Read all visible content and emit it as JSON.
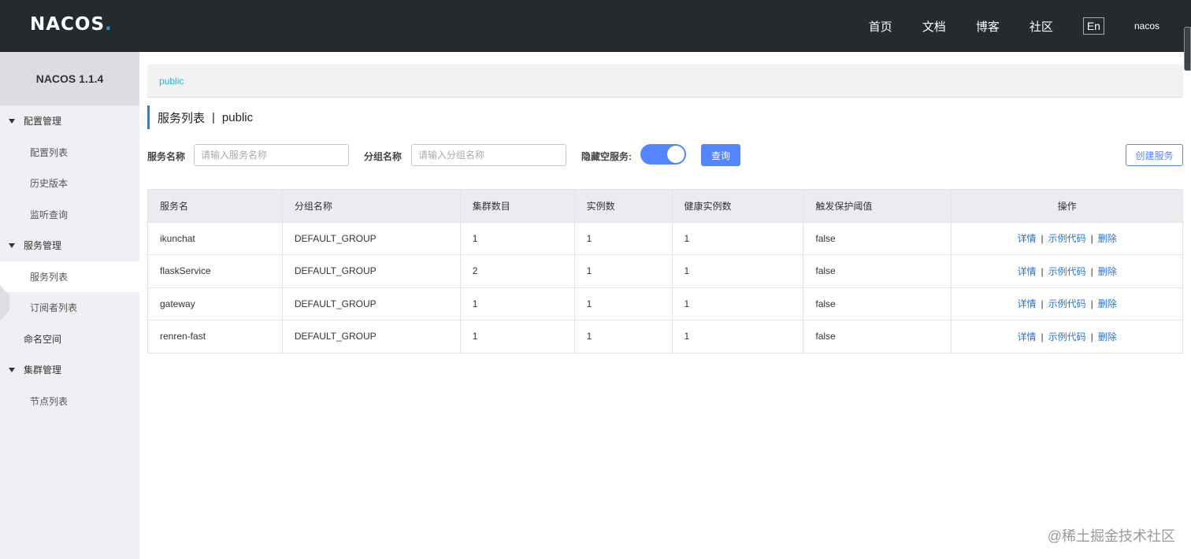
{
  "header": {
    "logo": "NACOS",
    "logo_dot": ".",
    "nav": [
      "首页",
      "文档",
      "博客",
      "社区"
    ],
    "lang": "En",
    "user": "nacos"
  },
  "sidebar": {
    "title": "NACOS 1.1.4",
    "groups": [
      {
        "label": "配置管理",
        "items": [
          "配置列表",
          "历史版本",
          "监听查询"
        ]
      },
      {
        "label": "服务管理",
        "items": [
          "服务列表",
          "订阅者列表"
        ]
      },
      {
        "label": "命名空间",
        "items": []
      },
      {
        "label": "集群管理",
        "items": [
          "节点列表"
        ]
      }
    ]
  },
  "main": {
    "breadcrumb": "public",
    "title": "服务列表",
    "title_sep": "|",
    "namespace": "public",
    "filters": {
      "service_label": "服务名称",
      "service_placeholder": "请输入服务名称",
      "group_label": "分组名称",
      "group_placeholder": "请输入分组名称",
      "hide_empty_label": "隐藏空服务:",
      "hide_empty_on": true,
      "query_btn": "查询",
      "create_btn": "创建服务"
    },
    "table": {
      "columns": [
        "服务名",
        "分组名称",
        "集群数目",
        "实例数",
        "健康实例数",
        "触发保护阈值",
        "操作"
      ],
      "rows": [
        {
          "name": "ikunchat",
          "group": "DEFAULT_GROUP",
          "clusters": "1",
          "instances": "1",
          "healthy": "1",
          "threshold": "false"
        },
        {
          "name": "flaskService",
          "group": "DEFAULT_GROUP",
          "clusters": "2",
          "instances": "1",
          "healthy": "1",
          "threshold": "false"
        },
        {
          "name": "gateway",
          "group": "DEFAULT_GROUP",
          "clusters": "1",
          "instances": "1",
          "healthy": "1",
          "threshold": "false"
        },
        {
          "name": "renren-fast",
          "group": "DEFAULT_GROUP",
          "clusters": "1",
          "instances": "1",
          "healthy": "1",
          "threshold": "false"
        }
      ],
      "ops": {
        "detail": "详情",
        "sample": "示例代码",
        "delete": "删除",
        "sep": "|"
      }
    }
  },
  "watermark": "@稀土掘金技术社区"
}
